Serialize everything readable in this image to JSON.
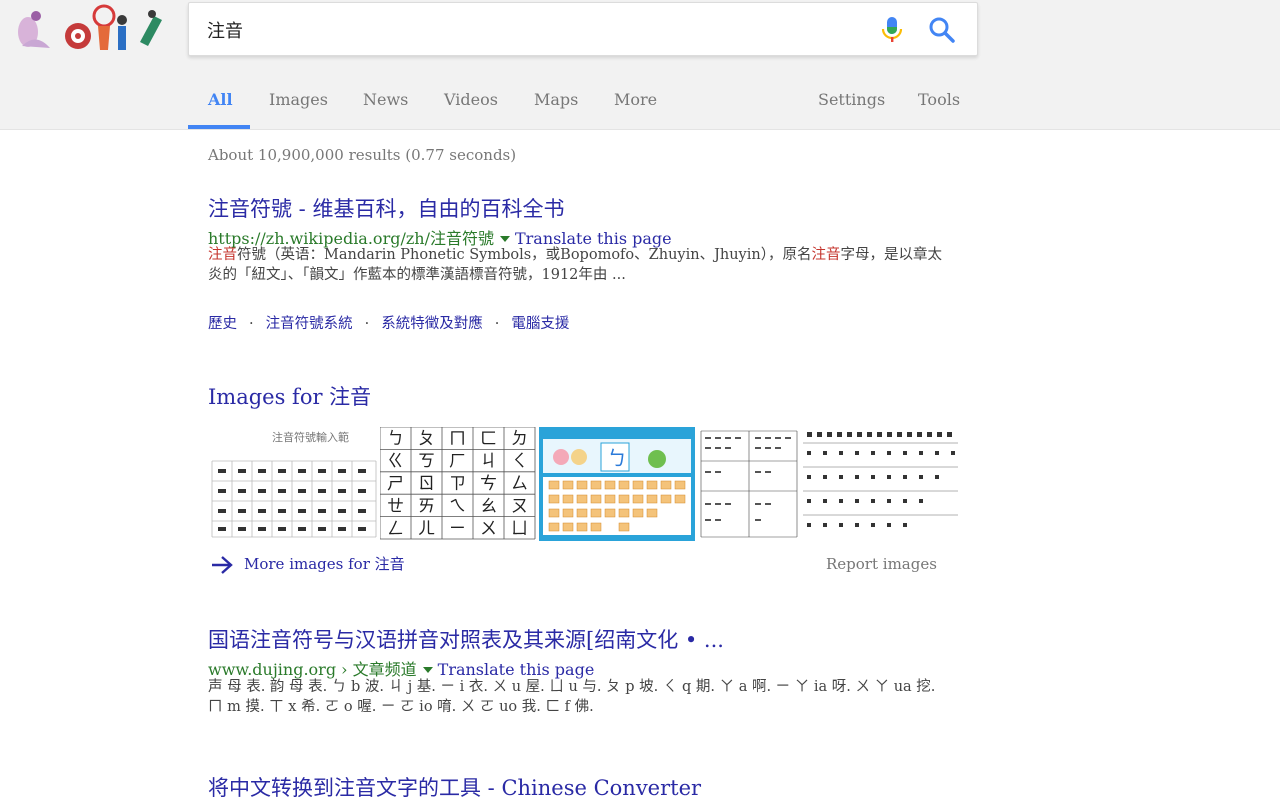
{
  "search": {
    "query": "注音"
  },
  "tabs": {
    "all": "All",
    "images": "Images",
    "news": "News",
    "videos": "Videos",
    "maps": "Maps",
    "more": "More",
    "settings": "Settings",
    "tools": "Tools"
  },
  "stats": "About 10,900,000 results (0.77 seconds)",
  "result1": {
    "title": "注音符號 - 维基百科，自由的百科全书",
    "url": "https://zh.wikipedia.org/zh/注音符號",
    "translate": "Translate this page",
    "snippet_em1": "注音",
    "snippet_part1": "符號（英语：Mandarin Phonetic Symbols，或Bopomofo、Zhuyin、Jhuyin），原名",
    "snippet_em2": "注音",
    "snippet_part2": "字母，是以章太炎的「紐文」、「韻文」作藍本的標準漢語標音符號，1912年由 ...",
    "sitelinks": [
      "歷史",
      "注音符號系統",
      "系統特徵及對應",
      "電腦支援"
    ]
  },
  "images_block": {
    "heading": "Images for 注音",
    "more": "More images for 注音",
    "report": "Report images",
    "thumb2_chars": [
      "ㄅ",
      "ㄆ",
      "ㄇ",
      "ㄈ",
      "ㄉ",
      "ㄍ",
      "ㄎ",
      "ㄏ",
      "ㄐ",
      "ㄑ",
      "ㄕ",
      "ㄖ",
      "ㄗ",
      "ㄘ",
      "ㄙ",
      "ㄝ",
      "ㄞ",
      "ㄟ",
      "ㄠ",
      "ㄡ",
      "ㄥ",
      "ㄦ",
      "ㄧ",
      "ㄨ",
      "ㄩ"
    ],
    "thumb1_caption": "注音符號輸入範",
    "thumb3_char": "ㄅ"
  },
  "result2": {
    "title": "国语注音符号与汉语拼音对照表及其来源[绍南文化 • ...",
    "url": "www.dujing.org › 文章频道",
    "translate": "Translate this page",
    "snippet": "声 母 表. 韵 母 表. ㄅ b 波. ㄐ j 基. ㄧ i 衣. ㄨ u 屋. ㄩ u 与. ㄆ p 坡. ㄑ q 期. ㄚ a 啊. ㄧ ㄚ ia 呀. ㄨ ㄚ ua 挖. ㄇ m 摸. ㄒ x 希. ㄛ o 喔. ㄧ ㄛ io 唷. ㄨ ㄛ uo 我. ㄈ f 佛."
  },
  "result3": {
    "title": "将中文转换到注音文字的工具 - Chinese Converter"
  },
  "colors": {
    "accent": "#4285f4",
    "link": "#2a2aa5",
    "url_green": "#2a7a2a",
    "header_bg": "#f2f2f2"
  }
}
